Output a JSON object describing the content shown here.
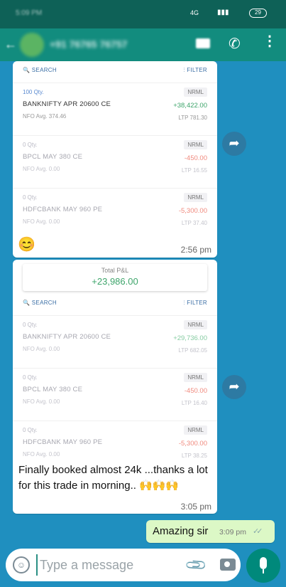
{
  "status_bar": {
    "time": "5:09 PM",
    "network": "4G",
    "signal": "▮▮▮",
    "battery": "29"
  },
  "header": {
    "back_icon": "arrow-left",
    "contact_name": "+91 76765 76757",
    "icons": [
      "video-camera",
      "phone",
      "more-vertical"
    ]
  },
  "screenshot_1": {
    "search_label": "SEARCH",
    "filter_label": "FILTER",
    "positions": [
      {
        "qty": "100 Qty.",
        "symbol": "BANKNIFTY APR 20600 CE",
        "avg": "NFO  Avg. 374.46",
        "product": "NRML",
        "pnl": "+38,422.00",
        "ltp": "LTP 781.30",
        "sign": "pos",
        "dim": false
      },
      {
        "qty": "0 Qty.",
        "symbol": "BPCL MAY 380 CE",
        "avg": "NFO  Avg. 0.00",
        "product": "NRML",
        "pnl": "-450.00",
        "ltp": "LTP 16.55",
        "sign": "neg",
        "dim": true
      },
      {
        "qty": "0 Qty.",
        "symbol": "HDFCBANK MAY 960 PE",
        "avg": "NFO  Avg. 0.00",
        "product": "NRML",
        "pnl": "-5,300.00",
        "ltp": "LTP 37.40",
        "sign": "neg",
        "dim": true
      }
    ],
    "emoji": "😊",
    "time": "2:56 pm"
  },
  "screenshot_2": {
    "total_pnl_label": "Total P&L",
    "total_pnl_value": "+23,986.00",
    "search_label": "SEARCH",
    "filter_label": "FILTER",
    "positions": [
      {
        "qty": "0 Qty.",
        "symbol": "BANKNIFTY APR 20600 CE",
        "avg": "NFO  Avg. 0.00",
        "product": "NRML",
        "pnl": "+29,736.00",
        "ltp": "LTP 682.05",
        "sign": "pos",
        "dim": true
      },
      {
        "qty": "0 Qty.",
        "symbol": "BPCL MAY 380 CE",
        "avg": "NFO  Avg. 0.00",
        "product": "NRML",
        "pnl": "-450.00",
        "ltp": "LTP 16.40",
        "sign": "neg",
        "dim": true
      },
      {
        "qty": "0 Qty.",
        "symbol": "HDFCBANK MAY 960 PE",
        "avg": "NFO  Avg. 0.00",
        "product": "NRML",
        "pnl": "-5,300.00",
        "ltp": "LTP 38.25",
        "sign": "neg",
        "dim": true
      }
    ],
    "caption": "Finally booked almost 24k ...thanks a lot for this trade in morning.. 🙌🙌🙌",
    "time": "3:05 pm"
  },
  "outgoing": {
    "text": "Amazing sir",
    "time": "3:09 pm",
    "ticks": "✓✓"
  },
  "composer": {
    "placeholder": "Type a message",
    "value": ""
  },
  "colors": {
    "chat_bg": "#1f8fbf",
    "header": "#128c7e",
    "outgoing_bubble": "#dcf8c6",
    "profit": "#3ea56b",
    "loss": "#f08a7e",
    "mic": "#00897b"
  }
}
